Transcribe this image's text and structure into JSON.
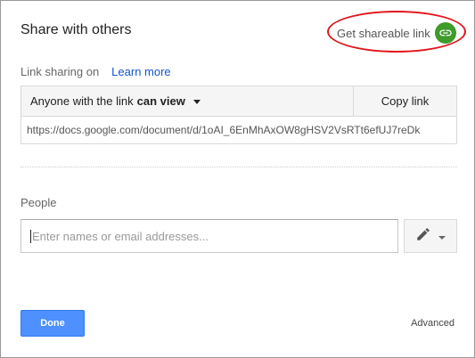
{
  "dialog": {
    "title": "Share with others",
    "get_link": {
      "label": "Get shareable link",
      "icon": "link-icon",
      "badge_color": "#3f9b2b"
    },
    "annotation_color": "#e0141b"
  },
  "link_sharing": {
    "label": "Link sharing on",
    "learn_more": "Learn more",
    "access_prefix": "Anyone with the link",
    "access_level": "can view",
    "copy_label": "Copy link",
    "url": "https://docs.google.com/document/d/1oAI_6EnMhAxOW8gHSV2VsRTt6efUJ7reDk"
  },
  "people": {
    "label": "People",
    "placeholder": "Enter names or email addresses...",
    "permission_icon": "pencil-icon"
  },
  "footer": {
    "done_label": "Done",
    "done_color": "#4d90fe",
    "advanced_label": "Advanced"
  }
}
